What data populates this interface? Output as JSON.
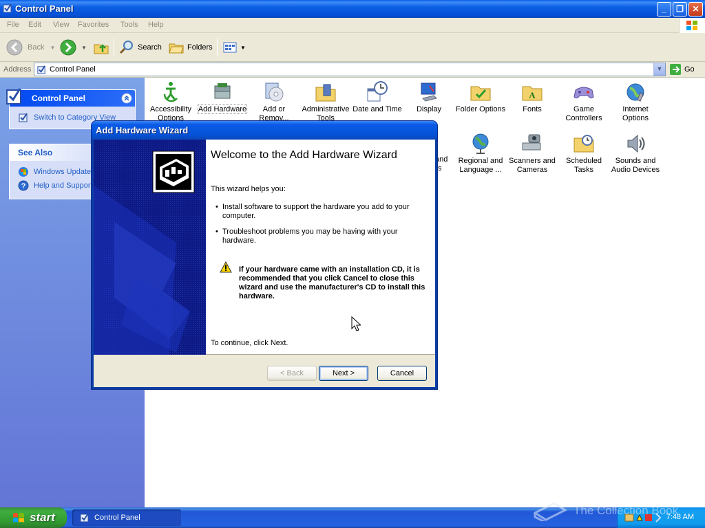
{
  "window": {
    "title": "Control Panel"
  },
  "menu": {
    "items": [
      "File",
      "Edit",
      "View",
      "Favorites",
      "Tools",
      "Help"
    ]
  },
  "toolbar": {
    "back": "Back",
    "search": "Search",
    "folders": "Folders"
  },
  "address": {
    "label": "Address",
    "value": "Control Panel",
    "go": "Go"
  },
  "sidebar": {
    "panel1": {
      "title": "Control Panel",
      "link": "Switch to Category View"
    },
    "panel2": {
      "title": "See Also",
      "links": [
        "Windows Update",
        "Help and Support"
      ]
    }
  },
  "icons": [
    {
      "l1": "Accessibility",
      "l2": "Options"
    },
    {
      "l1": "Add Hardware",
      "l2": ""
    },
    {
      "l1": "Add or",
      "l2": "Remov..."
    },
    {
      "l1": "Administrative",
      "l2": "Tools"
    },
    {
      "l1": "Date and Time",
      "l2": ""
    },
    {
      "l1": "Display",
      "l2": ""
    },
    {
      "l1": "Folder Options",
      "l2": ""
    },
    {
      "l1": "Fonts",
      "l2": ""
    },
    {
      "l1": "Game",
      "l2": "Controllers"
    },
    {
      "l1": "Internet",
      "l2": "Options"
    },
    {
      "l1": "and",
      "l2": "s"
    },
    {
      "l1": "Regional and",
      "l2": "Language ..."
    },
    {
      "l1": "Scanners and",
      "l2": "Cameras"
    },
    {
      "l1": "Scheduled",
      "l2": "Tasks"
    },
    {
      "l1": "Sounds and",
      "l2": "Audio Devices"
    }
  ],
  "dialog": {
    "title": "Add Hardware Wizard",
    "heading": "Welcome to the Add Hardware Wizard",
    "intro": "This wizard helps you:",
    "bullet1": "Install software to support the hardware you add to your computer.",
    "bullet2": "Troubleshoot problems you may be having with your hardware.",
    "warning": "If your hardware came with an installation CD, it is recommended that you click Cancel to close this wizard and use the manufacturer's CD to install this hardware.",
    "continue": "To continue, click Next.",
    "back_label": "< Back",
    "next_label": "Next >",
    "cancel_label": "Cancel"
  },
  "taskbar": {
    "start": "start",
    "task": "Control Panel",
    "clock": "7:48 AM"
  },
  "watermark": "The Collection Book",
  "colors": {
    "titlebar": "#0553d9",
    "taskbar": "#2663e0",
    "start": "#3fae3f",
    "sidebar": "#6375d6",
    "link": "#215dc6"
  }
}
